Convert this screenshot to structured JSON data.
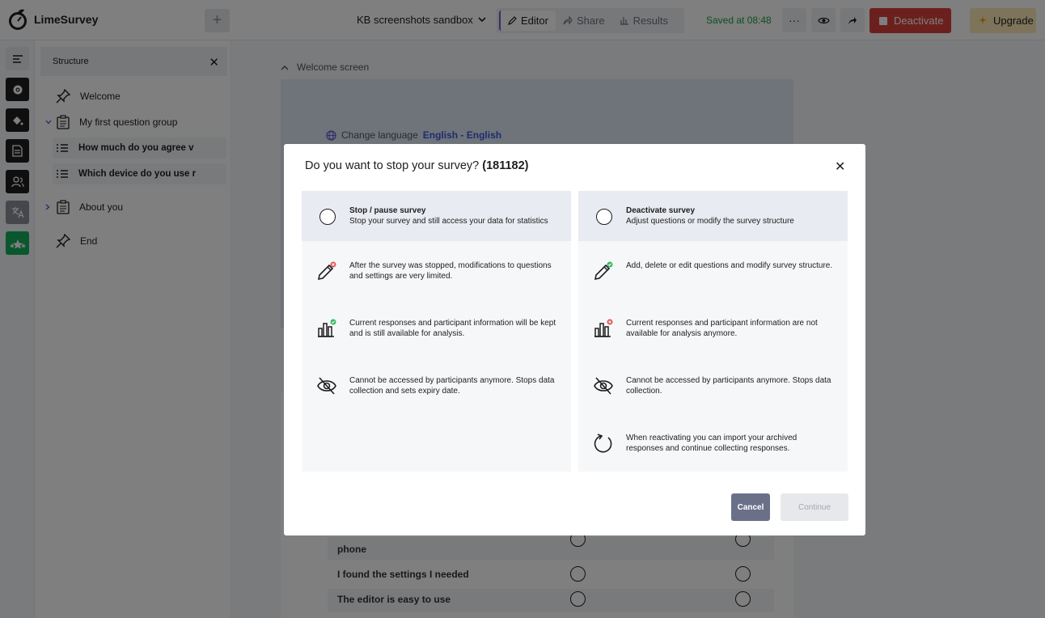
{
  "header": {
    "logo_text": "LimeSurvey",
    "add_symbol": "+",
    "survey_title": "KB screenshots sandbox",
    "tabs": [
      {
        "label": "Editor",
        "icon": "pencil-icon"
      },
      {
        "label": "Share",
        "icon": "share-icon"
      },
      {
        "label": "Results",
        "icon": "bar-chart-icon"
      }
    ],
    "saved_status": "Saved at 08:48",
    "more_symbol": "···",
    "deactivate_label": "Deactivate",
    "upgrade_label": "Upgrade"
  },
  "structure": {
    "title": "Structure",
    "items": {
      "welcome": "Welcome",
      "group1": "My first question group",
      "q1": "How much do you agree v",
      "q2": "Which device do you use r",
      "group2": "About you",
      "end": "End"
    }
  },
  "canvas": {
    "welcome_label": "Welcome screen",
    "change_language": "Change language",
    "language_value": "English - English",
    "rows": [
      "phone",
      "I found the settings I needed",
      "The editor is easy to use"
    ]
  },
  "modal": {
    "title": "Do you want to stop your survey?",
    "survey_id": "(181182)",
    "left": {
      "title": "Stop / pause survey",
      "subtitle": "Stop your survey and still access your data for statistics",
      "features": [
        "After the survey was stopped, modifications to questions and settings are very limited.",
        "Current responses and participant information will be kept and is still available for analysis.",
        "Cannot be accessed by participants anymore. Stops data collection and sets expiry date."
      ]
    },
    "right": {
      "title": "Deactivate survey",
      "subtitle": "Adjust questions or modify the survey structure",
      "features": [
        "Add, delete or edit questions and modify survey structure.",
        "Current responses and participant information are not available for analysis anymore.",
        "Cannot be accessed by participants anymore. Stops data collection.",
        "When reactivating you can import your archived responses and continue collecting responses."
      ]
    },
    "cancel_label": "Cancel",
    "continue_label": "Continue"
  },
  "colors": {
    "accent": "#6d5bd0",
    "danger": "#d9403c",
    "success": "#1e9e3f",
    "upgrade": "#fbe9b6"
  }
}
